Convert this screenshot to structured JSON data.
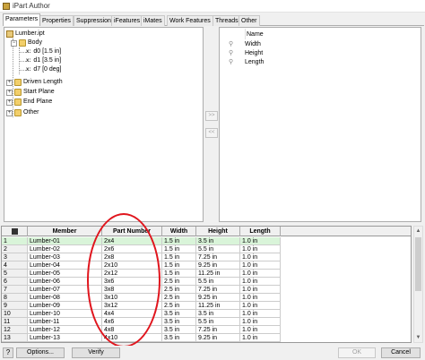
{
  "window": {
    "title": "iPart Author"
  },
  "tabs": [
    {
      "label": "Parameters",
      "active": true
    },
    {
      "label": "Properties"
    },
    {
      "label": "Suppression"
    },
    {
      "label": "iFeatures"
    },
    {
      "label": "iMates"
    },
    {
      "label": "Work Features"
    },
    {
      "label": "Threads"
    },
    {
      "label": "Other"
    }
  ],
  "tree": {
    "root": "Lumber.ipt",
    "body": "Body",
    "params": [
      "d0 [1.5 in]",
      "d1 [3.5 in]",
      "d7 [0 deg]"
    ],
    "param_marker": "x:",
    "nodes": [
      "Driven Length",
      "Start Plane",
      "End Plane",
      "Other"
    ]
  },
  "move_buttons": {
    "add": ">>",
    "remove": "<<"
  },
  "selected_list": {
    "header": "Name",
    "items": [
      "Width",
      "Height",
      "Length"
    ]
  },
  "grid": {
    "columns": [
      "Member",
      "Part Number",
      "Width",
      "Height",
      "Length"
    ],
    "rows": [
      {
        "num": "1",
        "member": "Lumber-01",
        "part": "2x4",
        "width": "1.5 in",
        "height": "3.5 in",
        "length": "1.0 in"
      },
      {
        "num": "2",
        "member": "Lumber-02",
        "part": "2x6",
        "width": "1.5 in",
        "height": "5.5 in",
        "length": "1.0 in"
      },
      {
        "num": "3",
        "member": "Lumber-03",
        "part": "2x8",
        "width": "1.5 in",
        "height": "7.25 in",
        "length": "1.0 in"
      },
      {
        "num": "4",
        "member": "Lumber-04",
        "part": "2x10",
        "width": "1.5 in",
        "height": "9.25 in",
        "length": "1.0 in"
      },
      {
        "num": "5",
        "member": "Lumber-05",
        "part": "2x12",
        "width": "1.5 in",
        "height": "11.25 in",
        "length": "1.0 in"
      },
      {
        "num": "6",
        "member": "Lumber-06",
        "part": "3x6",
        "width": "2.5 in",
        "height": "5.5 in",
        "length": "1.0 in"
      },
      {
        "num": "7",
        "member": "Lumber-07",
        "part": "3x8",
        "width": "2.5 in",
        "height": "7.25 in",
        "length": "1.0 in"
      },
      {
        "num": "8",
        "member": "Lumber-08",
        "part": "3x10",
        "width": "2.5 in",
        "height": "9.25 in",
        "length": "1.0 in"
      },
      {
        "num": "9",
        "member": "Lumber-09",
        "part": "3x12",
        "width": "2.5 in",
        "height": "11.25 in",
        "length": "1.0 in"
      },
      {
        "num": "10",
        "member": "Lumber-10",
        "part": "4x4",
        "width": "3.5 in",
        "height": "3.5 in",
        "length": "1.0 in"
      },
      {
        "num": "11",
        "member": "Lumber-11",
        "part": "4x6",
        "width": "3.5 in",
        "height": "5.5 in",
        "length": "1.0 in"
      },
      {
        "num": "12",
        "member": "Lumber-12",
        "part": "4x8",
        "width": "3.5 in",
        "height": "7.25 in",
        "length": "1.0 in"
      },
      {
        "num": "13",
        "member": "Lumber-13",
        "part": "4x10",
        "width": "3.5 in",
        "height": "9.25 in",
        "length": "1.0 in"
      }
    ]
  },
  "buttons": {
    "help": "?",
    "options": "Options...",
    "verify": "Verify",
    "ok": "OK",
    "cancel": "Cancel"
  },
  "colors": {
    "selected_row": "#d9f4d9",
    "annotation": "#e0151d"
  }
}
